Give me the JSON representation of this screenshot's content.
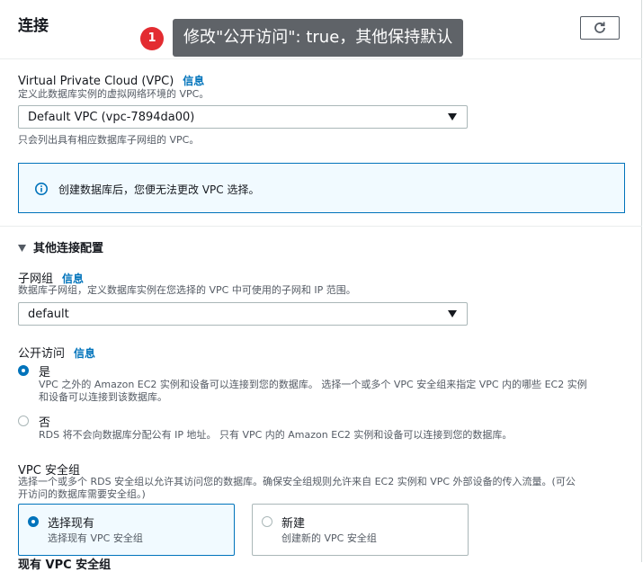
{
  "section": {
    "title": "连接",
    "refresh_icon": "refresh-icon"
  },
  "annotation": {
    "step_number": "1",
    "tooltip": "修改\"公开访问\": true，其他保持默认"
  },
  "vpc": {
    "label": "Virtual Private Cloud (VPC)",
    "info": "信息",
    "description": "定义此数据库实例的虚拟网络环境的 VPC。",
    "selected": "Default VPC (vpc-7894da00)",
    "hint": "只会列出具有相应数据库子网组的 VPC。"
  },
  "alert": {
    "icon": "info-circle-icon",
    "text": "创建数据库后，您便无法更改 VPC 选择。"
  },
  "additional_config": {
    "label": "其他连接配置"
  },
  "subnet_group": {
    "label": "子网组",
    "info": "信息",
    "description": "数据库子网组，定义数据库实例在您选择的 VPC 中可使用的子网和 IP 范围。",
    "selected": "default"
  },
  "public_access": {
    "label": "公开访问",
    "info": "信息",
    "options": [
      {
        "title": "是",
        "description_line1": "VPC 之外的 Amazon EC2 实例和设备可以连接到您的数据库。 选择一个或多个 VPC 安全组来指定 VPC 内的哪些 EC2 实例",
        "description_line2": "和设备可以连接到该数据库。",
        "checked": true
      },
      {
        "title": "否",
        "description_line1": "RDS 将不会向数据库分配公有 IP 地址。 只有 VPC 内的 Amazon EC2 实例和设备可以连接到您的数据库。",
        "checked": false
      }
    ]
  },
  "vpc_security_group": {
    "label": "VPC 安全组",
    "description_line1": "选择一个或多个 RDS 安全组以允许其访问您的数据库。确保安全组规则允许来自 EC2 实例和 VPC 外部设备的传入流量。(可公",
    "description_line2": "开访问的数据库需要安全组。)",
    "options": [
      {
        "title": "选择现有",
        "description": "选择现有 VPC 安全组",
        "checked": true
      },
      {
        "title": "新建",
        "description": "创建新的 VPC 安全组",
        "checked": false
      }
    ],
    "existing_label": "现有 VPC 安全组"
  },
  "colors": {
    "accent": "#0073bb",
    "badge": "#e32c31",
    "tooltip_bg": "#5f6368"
  }
}
